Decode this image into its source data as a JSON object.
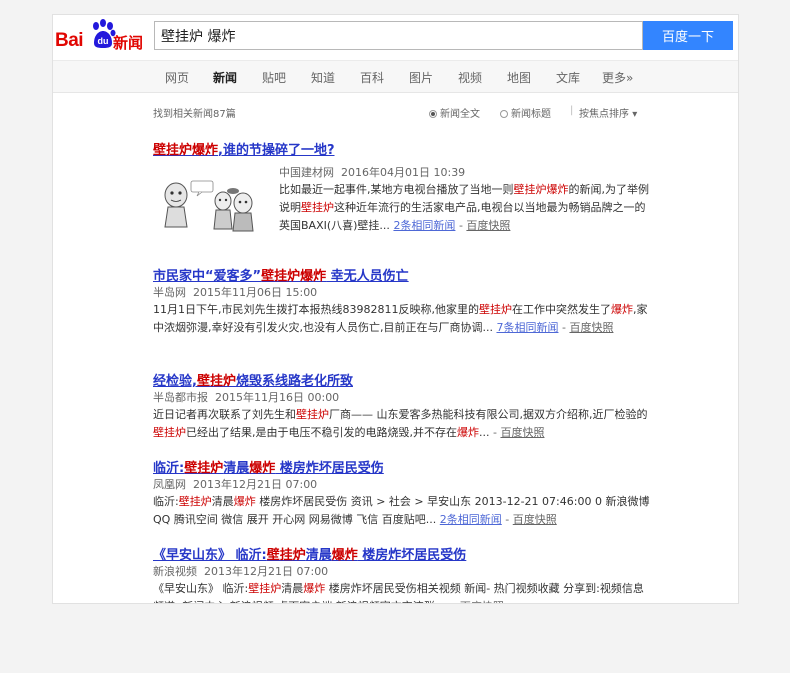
{
  "brand": {
    "bai": "Bai",
    "du": "du",
    "news": "新闻"
  },
  "search": {
    "query": "壁挂炉 爆炸",
    "button": "百度一下"
  },
  "nav": {
    "items": [
      "网页",
      "新闻",
      "贴吧",
      "知道",
      "百科",
      "图片",
      "视频",
      "地图",
      "文库",
      "更多»"
    ],
    "active_index": 1
  },
  "tools": {
    "count_text": "找到相关新闻87篇",
    "option_full": "新闻全文",
    "option_title": "新闻标题",
    "separator": "|",
    "sort_label": "按焦点排序",
    "sort_arrow": "▾"
  },
  "results": [
    {
      "title_parts": [
        {
          "t": "壁挂炉爆炸",
          "hl": true
        },
        {
          "t": ",谁的节操碎了一地?",
          "hl": false
        }
      ],
      "source": "中国建材网",
      "date": "2016年04月01日 10:39",
      "summary_parts": [
        {
          "t": "比如最近一起事件,某地方电视台播放了当地一则",
          "hl": false
        },
        {
          "t": "壁挂炉爆炸",
          "hl": true
        },
        {
          "t": "的新闻,为了举例说明",
          "hl": false
        },
        {
          "t": "壁挂炉",
          "hl": true
        },
        {
          "t": "这种近年流行的生活家电产品,电视台以当地最为畅销品牌之一的英国BAXI(八喜)壁挂...",
          "hl": false
        }
      ],
      "same_news": "2条相同新闻",
      "dash": "-",
      "snapshot": "百度快照"
    },
    {
      "title_parts": [
        {
          "t": "市民家中“爱客多”",
          "hl": false
        },
        {
          "t": "壁挂炉爆炸",
          "hl": true
        },
        {
          "t": " 幸无人员伤亡",
          "hl": false
        }
      ],
      "source": "半岛网",
      "date": "2015年11月06日 15:00",
      "summary_parts": [
        {
          "t": "11月1日下午,市民刘先生拨打本报热线83982811反映称,他家里的",
          "hl": false
        },
        {
          "t": "壁挂炉",
          "hl": true
        },
        {
          "t": "在工作中突然发生了",
          "hl": false
        },
        {
          "t": "爆炸",
          "hl": true
        },
        {
          "t": ",家中浓烟弥漫,幸好没有引发火灾,也没有人员伤亡,目前正在与厂商协调...",
          "hl": false
        }
      ],
      "same_news": "7条相同新闻",
      "dash": "-",
      "snapshot": "百度快照"
    },
    {
      "title_parts": [
        {
          "t": "经检验,",
          "hl": false
        },
        {
          "t": "壁挂炉",
          "hl": true
        },
        {
          "t": "烧毁系线路老化所致",
          "hl": false
        }
      ],
      "source": "半岛都市报",
      "date": "2015年11月16日 00:00",
      "summary_parts": [
        {
          "t": "近日记者再次联系了刘先生和",
          "hl": false
        },
        {
          "t": "壁挂炉",
          "hl": true
        },
        {
          "t": "厂商—— 山东爱客多热能科技有限公司,据双方介绍称,近厂检验的",
          "hl": false
        },
        {
          "t": "壁挂炉",
          "hl": true
        },
        {
          "t": "已经出了结果,是由于电压不稳引发的电路烧毁,并不存在",
          "hl": false
        },
        {
          "t": "爆炸",
          "hl": true
        },
        {
          "t": "...",
          "hl": false
        }
      ],
      "same_news": "",
      "dash": "-",
      "snapshot": "百度快照"
    },
    {
      "title_parts": [
        {
          "t": "临沂:",
          "hl": false
        },
        {
          "t": "壁挂炉",
          "hl": true
        },
        {
          "t": "清晨",
          "hl": false
        },
        {
          "t": "爆炸",
          "hl": true
        },
        {
          "t": " 楼房炸坏居民受伤",
          "hl": false
        }
      ],
      "source": "凤凰网",
      "date": "2013年12月21日 07:00",
      "summary_parts": [
        {
          "t": "临沂:",
          "hl": false
        },
        {
          "t": "壁挂炉",
          "hl": true
        },
        {
          "t": "清晨",
          "hl": false
        },
        {
          "t": "爆炸",
          "hl": true
        },
        {
          "t": " 楼房炸坏居民受伤 资讯 > 社会 > 早安山东 2013-12-21 07:46:00 0 新浪微博 QQ 腾讯空间 微信 展开 开心网 网易微博 飞信 百度贴吧...",
          "hl": false
        }
      ],
      "same_news": "2条相同新闻",
      "dash": "-",
      "snapshot": "百度快照"
    },
    {
      "title_parts": [
        {
          "t": "《早安山东》 临沂:",
          "hl": false
        },
        {
          "t": "壁挂炉",
          "hl": true
        },
        {
          "t": "清晨",
          "hl": false
        },
        {
          "t": "爆炸",
          "hl": true
        },
        {
          "t": " 楼房炸坏居民受伤",
          "hl": false
        }
      ],
      "source": "新浪视频",
      "date": "2013年12月21日 07:00",
      "summary_parts": [
        {
          "t": "《早安山东》 临沂:",
          "hl": false
        },
        {
          "t": "壁挂炉",
          "hl": true
        },
        {
          "t": "清晨",
          "hl": false
        },
        {
          "t": "爆炸",
          "hl": true
        },
        {
          "t": " 楼房炸坏居民受伤相关视频 新闻- 热门视频收藏 分享到:视频信息 频道: 新闻中心 新浪视频 桌面客户端 新浪视频官方交流群:...",
          "hl": false
        }
      ],
      "same_news": "",
      "dash": "-",
      "snapshot": "百度快照"
    }
  ],
  "colors": {
    "brand_red": "#e10602",
    "paw_blue": "#2319dc",
    "button_blue": "#3385ff",
    "title_blue": "#2637c8",
    "highlight_red": "#cc0000"
  },
  "icons": {
    "paw": "baidu-paw-icon",
    "radio": "radio-icon",
    "cartoon": "cartoon-thumbnail"
  }
}
